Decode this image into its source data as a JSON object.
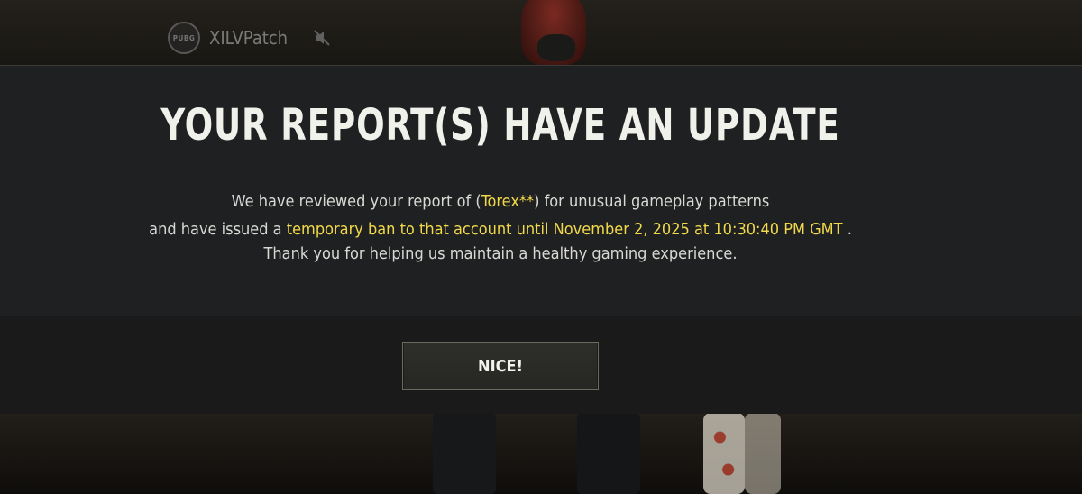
{
  "player": {
    "name": "XILVPatch",
    "logo_text": "PUBG"
  },
  "dialog": {
    "title": "YOUR REPORT(S) HAVE AN UPDATE",
    "line1_pre": "We have reviewed your report of (",
    "line1_name": "Torex**",
    "line1_post": ") for unusual gameplay patterns",
    "line2_pre": "and have issued a ",
    "line2_highlight": "temporary ban to that account until November 2, 2025 at 10:30:40 PM GMT",
    "line2_post": " .",
    "line3": "Thank you for helping us maintain a healthy gaming experience.",
    "button_label": "NICE!"
  },
  "colors": {
    "highlight": "#f1d94a",
    "panel": "#1f2022",
    "text": "#d9d9d4"
  },
  "icons": [
    "game-logo-icon",
    "mute-icon"
  ]
}
